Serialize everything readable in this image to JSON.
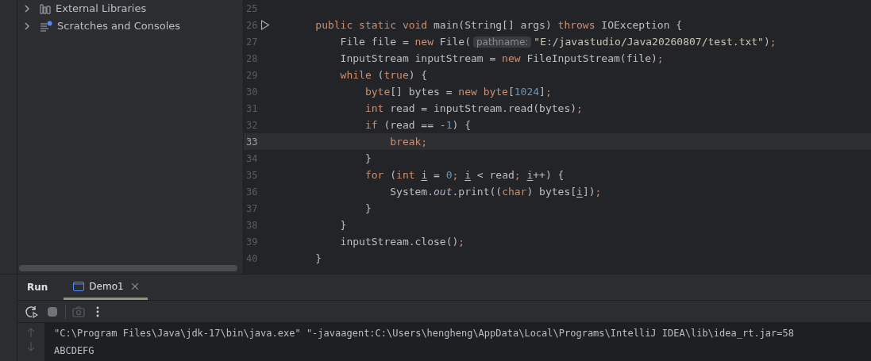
{
  "project_tree": [
    {
      "label": "External Libraries",
      "expanded": false
    },
    {
      "label": "Scratches and Consoles",
      "expanded": false
    }
  ],
  "editor": {
    "lines": [
      {
        "number": "25",
        "current": false,
        "runnable": false
      },
      {
        "number": "26",
        "current": false,
        "runnable": true,
        "tokens": [
          {
            "kind": "keyword",
            "text": "    public static void "
          },
          {
            "kind": "plain",
            "text": "main(String[] args) "
          },
          {
            "kind": "keyword",
            "text": "throws "
          },
          {
            "kind": "plain",
            "text": "IOException {"
          }
        ]
      },
      {
        "number": "27",
        "current": false,
        "runnable": false,
        "tokens": [
          {
            "kind": "plain",
            "text": "        File file = "
          },
          {
            "kind": "keyword",
            "text": "new "
          },
          {
            "kind": "plain",
            "text": "File("
          },
          {
            "kind": "hint",
            "text": "pathname:"
          },
          {
            "kind": "string",
            "text": "\"E:/javastudio/Java20260807/test.txt\""
          },
          {
            "kind": "plain",
            "text": ")"
          },
          {
            "kind": "keyword",
            "text": ";"
          }
        ]
      },
      {
        "number": "28",
        "current": false,
        "runnable": false,
        "tokens": [
          {
            "kind": "plain",
            "text": "        InputStream inputStream = "
          },
          {
            "kind": "keyword",
            "text": "new "
          },
          {
            "kind": "plain",
            "text": "FileInputStream(file)"
          },
          {
            "kind": "keyword",
            "text": ";"
          }
        ]
      },
      {
        "number": "29",
        "current": false,
        "runnable": false,
        "tokens": [
          {
            "kind": "keyword",
            "text": "        while "
          },
          {
            "kind": "plain",
            "text": "("
          },
          {
            "kind": "keyword",
            "text": "true"
          },
          {
            "kind": "plain",
            "text": ") {"
          }
        ]
      },
      {
        "number": "30",
        "current": false,
        "runnable": false,
        "tokens": [
          {
            "kind": "keyword",
            "text": "            byte"
          },
          {
            "kind": "plain",
            "text": "[] bytes = "
          },
          {
            "kind": "keyword",
            "text": "new byte"
          },
          {
            "kind": "plain",
            "text": "["
          },
          {
            "kind": "number",
            "text": "1024"
          },
          {
            "kind": "plain",
            "text": "]"
          },
          {
            "kind": "keyword",
            "text": ";"
          }
        ]
      },
      {
        "number": "31",
        "current": false,
        "runnable": false,
        "tokens": [
          {
            "kind": "keyword",
            "text": "            int "
          },
          {
            "kind": "plain",
            "text": "read = inputStream.read(bytes)"
          },
          {
            "kind": "keyword",
            "text": ";"
          }
        ]
      },
      {
        "number": "32",
        "current": false,
        "runnable": false,
        "tokens": [
          {
            "kind": "keyword",
            "text": "            if "
          },
          {
            "kind": "plain",
            "text": "(read == -"
          },
          {
            "kind": "number",
            "text": "1"
          },
          {
            "kind": "plain",
            "text": ") {"
          }
        ]
      },
      {
        "number": "33",
        "current": true,
        "runnable": false,
        "tokens": [
          {
            "kind": "keyword",
            "text": "                break;"
          }
        ]
      },
      {
        "number": "34",
        "current": false,
        "runnable": false,
        "tokens": [
          {
            "kind": "plain",
            "text": "            }"
          }
        ]
      },
      {
        "number": "35",
        "current": false,
        "runnable": false,
        "tokens": [
          {
            "kind": "keyword",
            "text": "            for "
          },
          {
            "kind": "plain",
            "text": "("
          },
          {
            "kind": "keyword",
            "text": "int "
          },
          {
            "kind": "variable",
            "text": "i"
          },
          {
            "kind": "plain",
            "text": " = "
          },
          {
            "kind": "number",
            "text": "0"
          },
          {
            "kind": "keyword",
            "text": "; "
          },
          {
            "kind": "variable",
            "text": "i"
          },
          {
            "kind": "plain",
            "text": " < read"
          },
          {
            "kind": "keyword",
            "text": "; "
          },
          {
            "kind": "variable",
            "text": "i"
          },
          {
            "kind": "plain",
            "text": "++) {"
          }
        ]
      },
      {
        "number": "36",
        "current": false,
        "runnable": false,
        "tokens": [
          {
            "kind": "plain",
            "text": "                System."
          },
          {
            "kind": "field",
            "text": "out"
          },
          {
            "kind": "plain",
            "text": ".print(("
          },
          {
            "kind": "keyword",
            "text": "char"
          },
          {
            "kind": "plain",
            "text": ") bytes["
          },
          {
            "kind": "variable",
            "text": "i"
          },
          {
            "kind": "plain",
            "text": "])"
          },
          {
            "kind": "keyword",
            "text": ";"
          }
        ]
      },
      {
        "number": "37",
        "current": false,
        "runnable": false,
        "tokens": [
          {
            "kind": "plain",
            "text": "            }"
          }
        ]
      },
      {
        "number": "38",
        "current": false,
        "runnable": false,
        "tokens": [
          {
            "kind": "plain",
            "text": "        }"
          }
        ]
      },
      {
        "number": "39",
        "current": false,
        "runnable": false,
        "tokens": [
          {
            "kind": "plain",
            "text": "        inputStream.close()"
          },
          {
            "kind": "keyword",
            "text": ";"
          }
        ]
      },
      {
        "number": "40",
        "current": false,
        "runnable": false,
        "tokens": [
          {
            "kind": "plain",
            "text": "    }"
          }
        ]
      }
    ]
  },
  "run_panel": {
    "title": "Run",
    "tabs": [
      {
        "label": "Demo1",
        "selected": true
      }
    ],
    "toolbar": [
      {
        "kind": "rerun",
        "disabled": false
      },
      {
        "kind": "stop",
        "disabled": false
      },
      {
        "kind": "camera",
        "disabled": true
      },
      {
        "kind": "more",
        "disabled": false
      }
    ],
    "console": [
      "\"C:\\Program Files\\Java\\jdk-17\\bin\\java.exe\" \"-javaagent:C:\\Users\\hengheng\\AppData\\Local\\Programs\\IntelliJ IDEA\\lib\\idea_rt.jar=58",
      "ABCDEFG"
    ]
  }
}
